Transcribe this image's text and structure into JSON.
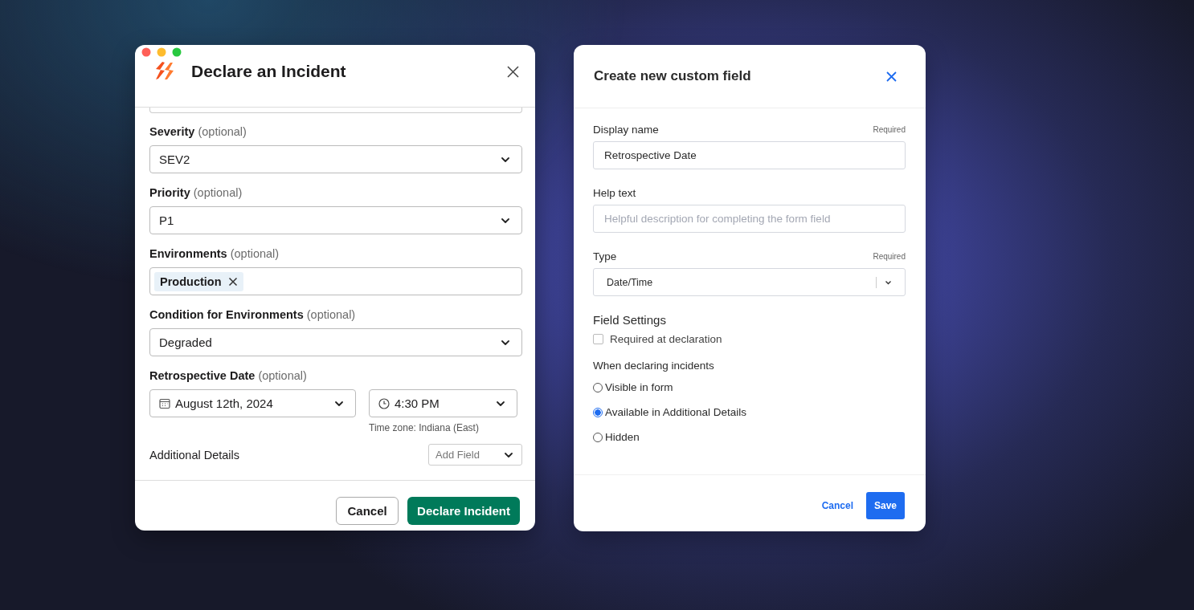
{
  "incident_dialog": {
    "title": "Declare an Incident",
    "fields": [
      {
        "kind": "select",
        "label": "**Severity** (optional)",
        "value": "SEV2"
      },
      {
        "kind": "select",
        "label": "**Priority** (optional)",
        "value": "P1"
      },
      {
        "kind": "tags",
        "label": "**Environments** (optional)",
        "tags": [
          "Production"
        ]
      },
      {
        "kind": "select",
        "label": "**Condition for Environments** (optional)",
        "value": "Degraded"
      },
      {
        "kind": "datetime",
        "label": "**Retrospective Date** (optional)",
        "date": "August 12th, 2024",
        "time": "4:30 PM",
        "timezone": "Time zone: Indiana (East)"
      }
    ],
    "additional_details": {
      "label": "Additional Details",
      "placeholder": "Add Field"
    },
    "buttons": [
      {
        "label": "Cancel",
        "kind": "secondary"
      },
      {
        "label": "Declare Incident",
        "kind": "primary"
      }
    ]
  },
  "custom_field_dialog": {
    "title": "Create new custom field",
    "inputs": [
      {
        "kind": "text",
        "label": "Display name",
        "required": "Required",
        "value": "Retrospective Date"
      },
      {
        "kind": "text",
        "label": "Help text",
        "placeholder": "Helpful description for completing the form field"
      },
      {
        "kind": "select",
        "label": "Type",
        "required": "Required",
        "value": "Date/Time"
      }
    ],
    "settings": {
      "title": "Field Settings",
      "checkbox": {
        "label": "Required at declaration",
        "checked": false
      },
      "radio_title": "When declaring incidents",
      "options": [
        {
          "label": "Visible in form",
          "selected": false
        },
        {
          "label": "Available in Additional Details",
          "selected": true
        },
        {
          "label": "Hidden",
          "selected": false
        }
      ]
    },
    "buttons": [
      {
        "label": "Cancel",
        "kind": "secondary"
      },
      {
        "label": "Save",
        "kind": "primary"
      }
    ]
  }
}
